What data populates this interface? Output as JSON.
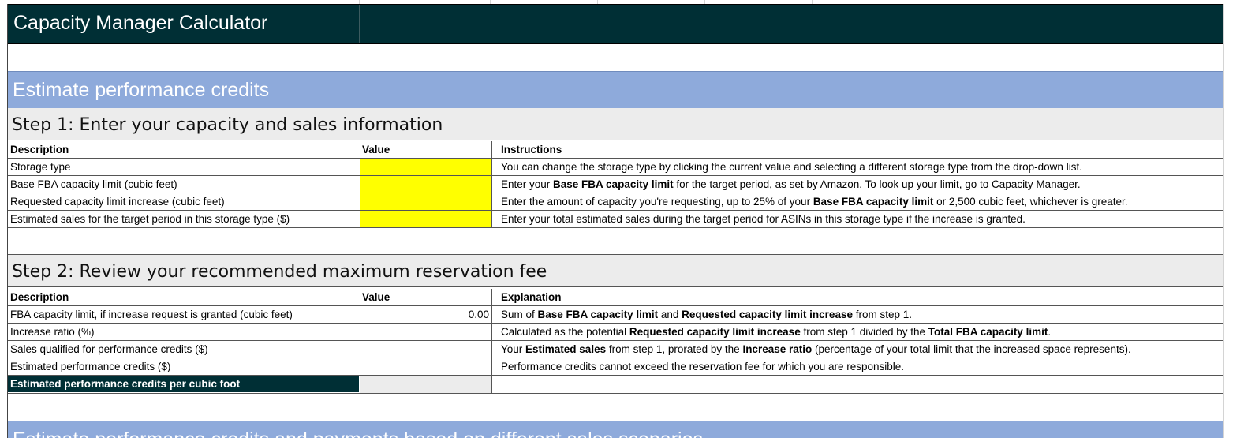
{
  "title": "Capacity Manager Calculator",
  "section1": {
    "title": "Estimate performance credits"
  },
  "step1": {
    "title": "Step 1: Enter your capacity and sales information",
    "headers": {
      "description": "Description",
      "value": "Value",
      "instructions": "Instructions"
    },
    "rows": [
      {
        "description": "Storage type",
        "value": "",
        "instruction": [
          {
            "t": "You can change the storage type by clicking the current value and selecting a different storage type from the drop-down list.",
            "b": false
          }
        ]
      },
      {
        "description": "Base FBA capacity limit (cubic feet)",
        "value": "",
        "instruction": [
          {
            "t": "Enter your ",
            "b": false
          },
          {
            "t": "Base FBA capacity limit",
            "b": true
          },
          {
            "t": " for the target period, as set by Amazon. To look up your limit, go to Capacity Manager.",
            "b": false
          }
        ]
      },
      {
        "description": "Requested capacity limit increase (cubic feet)",
        "value": "",
        "instruction": [
          {
            "t": "Enter the amount of capacity you're requesting, up to 25% of your ",
            "b": false
          },
          {
            "t": "Base FBA capacity limit",
            "b": true
          },
          {
            "t": " or 2,500 cubic feet, whichever is greater.",
            "b": false
          }
        ]
      },
      {
        "description": "Estimated sales for the target period in this storage type ($)",
        "value": "",
        "instruction": [
          {
            "t": "Enter your total estimated sales during the target period for ASINs in this storage type if the increase is granted.",
            "b": false
          }
        ]
      }
    ]
  },
  "step2": {
    "title": "Step 2: Review your recommended maximum reservation fee",
    "headers": {
      "description": "Description",
      "value": "Value",
      "explanation": "Explanation"
    },
    "rows": [
      {
        "description": "FBA capacity limit, if increase request is granted (cubic feet)",
        "value": "0.00",
        "explanation": [
          {
            "t": "Sum of ",
            "b": false
          },
          {
            "t": "Base FBA capacity limit",
            "b": true
          },
          {
            "t": " and ",
            "b": false
          },
          {
            "t": "Requested capacity limit increase",
            "b": true
          },
          {
            "t": " from step 1.",
            "b": false
          }
        ]
      },
      {
        "description": "Increase ratio (%)",
        "value": "",
        "explanation": [
          {
            "t": "Calculated as the potential ",
            "b": false
          },
          {
            "t": "Requested capacity limit increase",
            "b": true
          },
          {
            "t": " from step 1 divided by the ",
            "b": false
          },
          {
            "t": "Total FBA capacity limit",
            "b": true
          },
          {
            "t": ".",
            "b": false
          }
        ]
      },
      {
        "description": "Sales qualified for performance credits ($)",
        "value": "",
        "explanation": [
          {
            "t": "Your ",
            "b": false
          },
          {
            "t": "Estimated sales",
            "b": true
          },
          {
            "t": " from step 1, prorated by the ",
            "b": false
          },
          {
            "t": "Increase ratio",
            "b": true
          },
          {
            "t": " (percentage of your total limit that the increased space represents).",
            "b": false
          }
        ]
      },
      {
        "description": "Estimated performance credits ($)",
        "value": "",
        "explanation": [
          {
            "t": "Performance credits cannot exceed the reservation fee for which you are responsible.",
            "b": false
          }
        ]
      }
    ],
    "summary_label": "Estimated performance credits per cubic foot",
    "summary_value": ""
  },
  "section2": {
    "title": "Estimate performance credits and payments based on different sales scenarios"
  },
  "colors": {
    "title_bg": "#002f35",
    "section_bg": "#8eaadb",
    "input_cell": "#ffff00",
    "step_bg": "#ececec"
  }
}
